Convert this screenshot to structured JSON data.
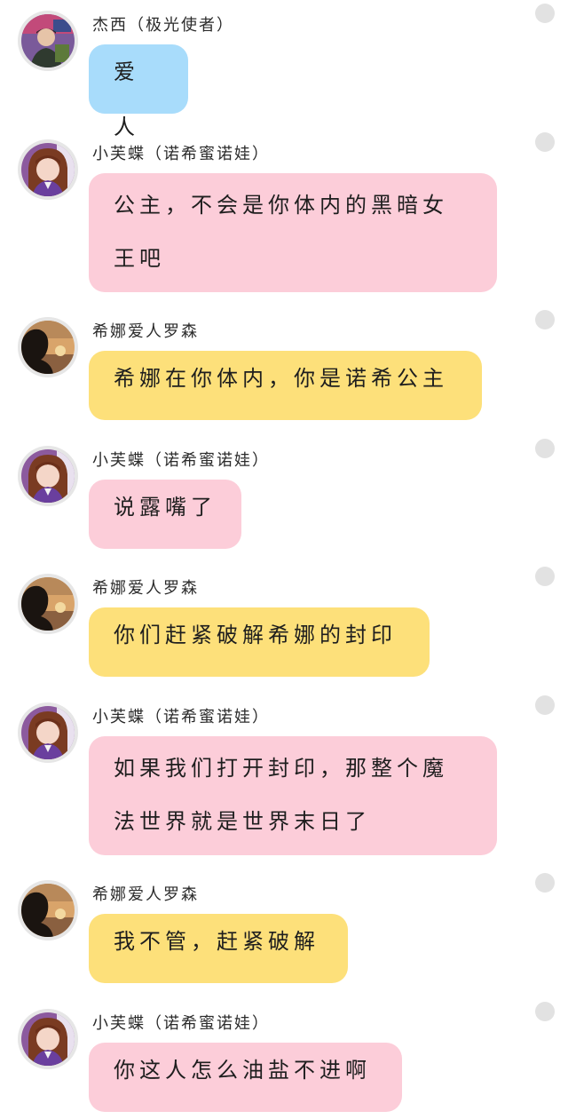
{
  "colors": {
    "bubble_blue": "#a8dcfb",
    "bubble_pink": "#fccdd9",
    "bubble_yellow": "#fde07a",
    "avatar_ring": "#e6e6e6",
    "status_dot": "#e2e2e2"
  },
  "messages": [
    {
      "sender": "杰西（极光使者）",
      "text": "爱人",
      "bubble_color": "blue",
      "avatar": "jessie-avatar"
    },
    {
      "sender": "小芙蝶（诺希蜜诺娃）",
      "text": "公主，不会是你体内的黑暗女王吧",
      "bubble_color": "pink",
      "avatar": "xiaofudie-avatar"
    },
    {
      "sender": "希娜爱人罗森",
      "text": "希娜在你体内，你是诺希公主",
      "bubble_color": "yellow",
      "avatar": "rosen-avatar"
    },
    {
      "sender": "小芙蝶（诺希蜜诺娃）",
      "text": "说露嘴了",
      "bubble_color": "pink",
      "avatar": "xiaofudie-avatar"
    },
    {
      "sender": "希娜爱人罗森",
      "text": "你们赶紧破解希娜的封印",
      "bubble_color": "yellow",
      "avatar": "rosen-avatar"
    },
    {
      "sender": "小芙蝶（诺希蜜诺娃）",
      "text": "如果我们打开封印，那整个魔法世界就是世界末日了",
      "bubble_color": "pink",
      "avatar": "xiaofudie-avatar"
    },
    {
      "sender": "希娜爱人罗森",
      "text": "我不管，赶紧破解",
      "bubble_color": "yellow",
      "avatar": "rosen-avatar"
    },
    {
      "sender": "小芙蝶（诺希蜜诺娃）",
      "text": "你这人怎么油盐不进啊",
      "bubble_color": "pink",
      "avatar": "xiaofudie-avatar"
    }
  ]
}
